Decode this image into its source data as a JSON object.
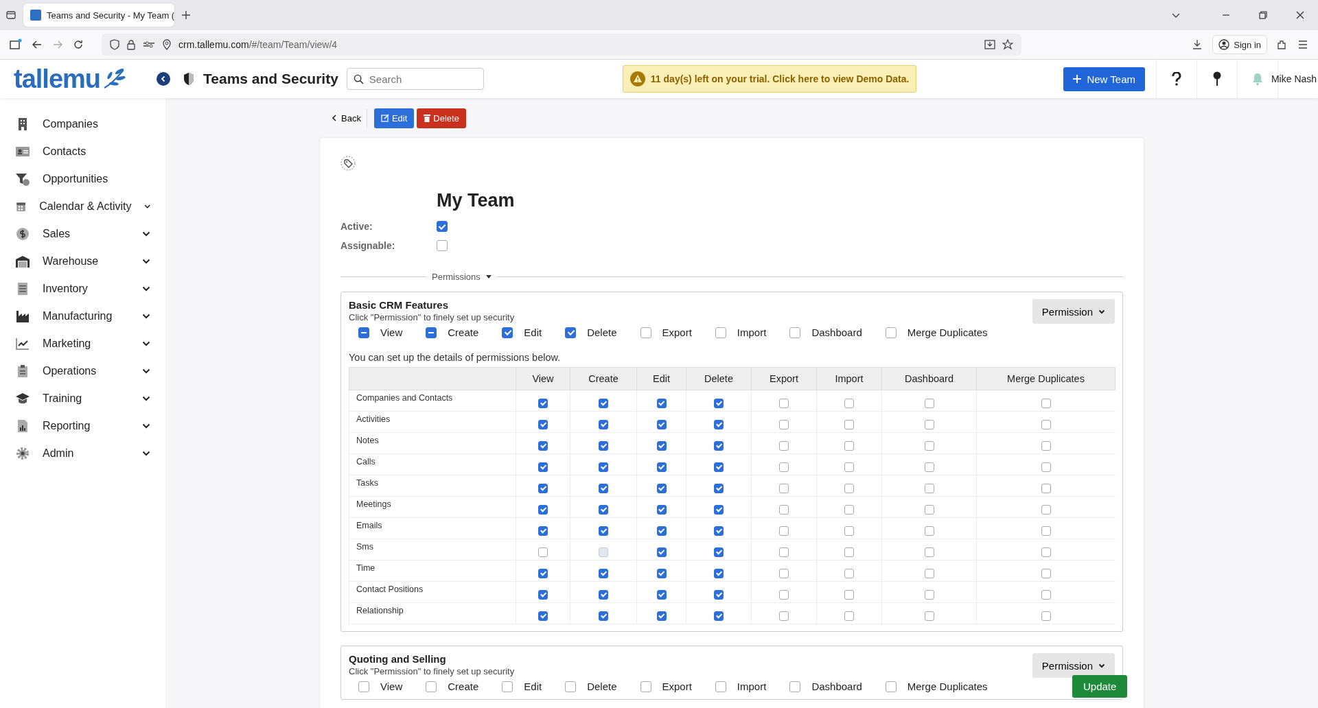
{
  "browser": {
    "tab_title": "Teams and Security - My Team (",
    "url_host": "crm.tallemu.com",
    "url_path": "/#/team/Team/view/4",
    "sign_in": "Sign in"
  },
  "header": {
    "logo": "tallemu",
    "title": "Teams and Security",
    "search": {
      "placeholder": "Search"
    },
    "trial_banner": "11 day(s) left on your trial. Click here to view Demo Data.",
    "new_button": "New Team",
    "user": "Mike Nash"
  },
  "sidebar": {
    "items": [
      {
        "label": "Companies",
        "expandable": false
      },
      {
        "label": "Contacts",
        "expandable": false
      },
      {
        "label": "Opportunities",
        "expandable": false
      },
      {
        "label": "Calendar & Activity",
        "expandable": true
      },
      {
        "label": "Sales",
        "expandable": true
      },
      {
        "label": "Warehouse",
        "expandable": true
      },
      {
        "label": "Inventory",
        "expandable": true
      },
      {
        "label": "Manufacturing",
        "expandable": true
      },
      {
        "label": "Marketing",
        "expandable": true
      },
      {
        "label": "Operations",
        "expandable": true
      },
      {
        "label": "Training",
        "expandable": true
      },
      {
        "label": "Reporting",
        "expandable": true
      },
      {
        "label": "Admin",
        "expandable": true
      }
    ]
  },
  "toolbar": {
    "back": "Back",
    "edit": "Edit",
    "delete": "Delete"
  },
  "team": {
    "name": "My Team",
    "fields": [
      {
        "label": "Active:",
        "checked": true
      },
      {
        "label": "Assignable:",
        "checked": false
      }
    ]
  },
  "permissions_label": "Permissions",
  "sections": [
    {
      "title": "Basic CRM Features",
      "subtitle": "Click \"Permission\" to finely set up security",
      "button": "Permission",
      "toggles": [
        {
          "label": "View",
          "checked": true,
          "partial": true
        },
        {
          "label": "Create",
          "checked": true,
          "partial": true
        },
        {
          "label": "Edit",
          "checked": true,
          "partial": false
        },
        {
          "label": "Delete",
          "checked": true,
          "partial": false
        },
        {
          "label": "Export",
          "checked": false,
          "partial": false
        },
        {
          "label": "Import",
          "checked": false,
          "partial": false
        },
        {
          "label": "Dashboard",
          "checked": false,
          "partial": false
        },
        {
          "label": "Merge Duplicates",
          "checked": false,
          "partial": false
        }
      ],
      "note": "You can set up the details of permissions below.",
      "table": {
        "columns": [
          "View",
          "Create",
          "Edit",
          "Delete",
          "Export",
          "Import",
          "Dashboard",
          "Merge Duplicates"
        ],
        "rows": [
          {
            "name": "Companies and Contacts",
            "cells": [
              {
                "checked": true,
                "disabled": false
              },
              {
                "checked": true,
                "disabled": false
              },
              {
                "checked": true,
                "disabled": false
              },
              {
                "checked": true,
                "disabled": false
              },
              {
                "checked": false,
                "disabled": false
              },
              {
                "checked": false,
                "disabled": false
              },
              {
                "checked": false,
                "disabled": false
              },
              {
                "checked": false,
                "disabled": false
              }
            ]
          },
          {
            "name": "Activities",
            "cells": [
              {
                "checked": true,
                "disabled": false
              },
              {
                "checked": true,
                "disabled": false
              },
              {
                "checked": true,
                "disabled": false
              },
              {
                "checked": true,
                "disabled": false
              },
              {
                "checked": false,
                "disabled": false
              },
              {
                "checked": false,
                "disabled": false
              },
              {
                "checked": false,
                "disabled": false
              },
              {
                "checked": false,
                "disabled": false
              }
            ]
          },
          {
            "name": "Notes",
            "cells": [
              {
                "checked": true,
                "disabled": false
              },
              {
                "checked": true,
                "disabled": false
              },
              {
                "checked": true,
                "disabled": false
              },
              {
                "checked": true,
                "disabled": false
              },
              {
                "checked": false,
                "disabled": false
              },
              {
                "checked": false,
                "disabled": false
              },
              {
                "checked": false,
                "disabled": false
              },
              {
                "checked": false,
                "disabled": false
              }
            ]
          },
          {
            "name": "Calls",
            "cells": [
              {
                "checked": true,
                "disabled": false
              },
              {
                "checked": true,
                "disabled": false
              },
              {
                "checked": true,
                "disabled": false
              },
              {
                "checked": true,
                "disabled": false
              },
              {
                "checked": false,
                "disabled": false
              },
              {
                "checked": false,
                "disabled": false
              },
              {
                "checked": false,
                "disabled": false
              },
              {
                "checked": false,
                "disabled": false
              }
            ]
          },
          {
            "name": "Tasks",
            "cells": [
              {
                "checked": true,
                "disabled": false
              },
              {
                "checked": true,
                "disabled": false
              },
              {
                "checked": true,
                "disabled": false
              },
              {
                "checked": true,
                "disabled": false
              },
              {
                "checked": false,
                "disabled": false
              },
              {
                "checked": false,
                "disabled": false
              },
              {
                "checked": false,
                "disabled": false
              },
              {
                "checked": false,
                "disabled": false
              }
            ]
          },
          {
            "name": "Meetings",
            "cells": [
              {
                "checked": true,
                "disabled": false
              },
              {
                "checked": true,
                "disabled": false
              },
              {
                "checked": true,
                "disabled": false
              },
              {
                "checked": true,
                "disabled": false
              },
              {
                "checked": false,
                "disabled": false
              },
              {
                "checked": false,
                "disabled": false
              },
              {
                "checked": false,
                "disabled": false
              },
              {
                "checked": false,
                "disabled": false
              }
            ]
          },
          {
            "name": "Emails",
            "cells": [
              {
                "checked": true,
                "disabled": false
              },
              {
                "checked": true,
                "disabled": false
              },
              {
                "checked": true,
                "disabled": false
              },
              {
                "checked": true,
                "disabled": false
              },
              {
                "checked": false,
                "disabled": false
              },
              {
                "checked": false,
                "disabled": false
              },
              {
                "checked": false,
                "disabled": false
              },
              {
                "checked": false,
                "disabled": false
              }
            ]
          },
          {
            "name": "Sms",
            "cells": [
              {
                "checked": false,
                "disabled": false
              },
              {
                "checked": false,
                "disabled": true
              },
              {
                "checked": true,
                "disabled": false
              },
              {
                "checked": true,
                "disabled": false
              },
              {
                "checked": false,
                "disabled": false
              },
              {
                "checked": false,
                "disabled": false
              },
              {
                "checked": false,
                "disabled": false
              },
              {
                "checked": false,
                "disabled": false
              }
            ]
          },
          {
            "name": "Time",
            "cells": [
              {
                "checked": true,
                "disabled": false
              },
              {
                "checked": true,
                "disabled": false
              },
              {
                "checked": true,
                "disabled": false
              },
              {
                "checked": true,
                "disabled": false
              },
              {
                "checked": false,
                "disabled": false
              },
              {
                "checked": false,
                "disabled": false
              },
              {
                "checked": false,
                "disabled": false
              },
              {
                "checked": false,
                "disabled": false
              }
            ]
          },
          {
            "name": "Contact Positions",
            "cells": [
              {
                "checked": true,
                "disabled": false
              },
              {
                "checked": true,
                "disabled": false
              },
              {
                "checked": true,
                "disabled": false
              },
              {
                "checked": true,
                "disabled": false
              },
              {
                "checked": false,
                "disabled": false
              },
              {
                "checked": false,
                "disabled": false
              },
              {
                "checked": false,
                "disabled": false
              },
              {
                "checked": false,
                "disabled": false
              }
            ]
          },
          {
            "name": "Relationship",
            "cells": [
              {
                "checked": true,
                "disabled": false
              },
              {
                "checked": true,
                "disabled": false
              },
              {
                "checked": true,
                "disabled": false
              },
              {
                "checked": true,
                "disabled": false
              },
              {
                "checked": false,
                "disabled": false
              },
              {
                "checked": false,
                "disabled": false
              },
              {
                "checked": false,
                "disabled": false
              },
              {
                "checked": false,
                "disabled": false
              }
            ]
          }
        ]
      }
    },
    {
      "title": "Quoting and Selling",
      "subtitle": "Click \"Permission\" to finely set up security",
      "button": "Permission",
      "toggles": [
        {
          "label": "View",
          "checked": false,
          "partial": false
        },
        {
          "label": "Create",
          "checked": false,
          "partial": false
        },
        {
          "label": "Edit",
          "checked": false,
          "partial": false
        },
        {
          "label": "Delete",
          "checked": false,
          "partial": false
        },
        {
          "label": "Export",
          "checked": false,
          "partial": false
        },
        {
          "label": "Import",
          "checked": false,
          "partial": false
        },
        {
          "label": "Dashboard",
          "checked": false,
          "partial": false
        },
        {
          "label": "Merge Duplicates",
          "checked": false,
          "partial": false
        }
      ]
    }
  ],
  "update_button": "Update"
}
